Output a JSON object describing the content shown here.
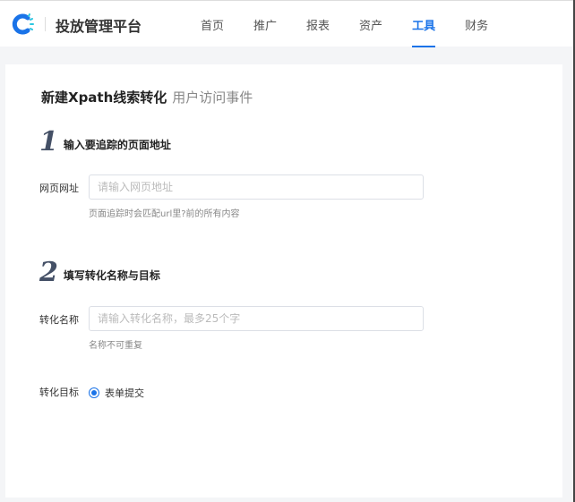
{
  "header": {
    "brand": "投放管理平台",
    "nav": [
      "首页",
      "推广",
      "报表",
      "资产",
      "工具",
      "财务"
    ],
    "active": "工具"
  },
  "page": {
    "title": "新建Xpath线索转化",
    "subtitle": "用户访问事件"
  },
  "step1": {
    "num": "1",
    "title": "输入要追踪的页面地址",
    "label": "网页网址",
    "placeholder": "请输入网页地址",
    "value": "",
    "hint": "页面追踪时会匹配url里?前的所有内容"
  },
  "step2": {
    "num": "2",
    "title": "填写转化名称与目标",
    "name_label": "转化名称",
    "name_placeholder": "请输入转化名称，最多25个字",
    "name_value": "",
    "name_hint": "名称不可重复",
    "goal_label": "转化目标",
    "goal_option": "表单提交",
    "goal_selected": true
  },
  "colors": {
    "accent": "#1a73e8"
  }
}
